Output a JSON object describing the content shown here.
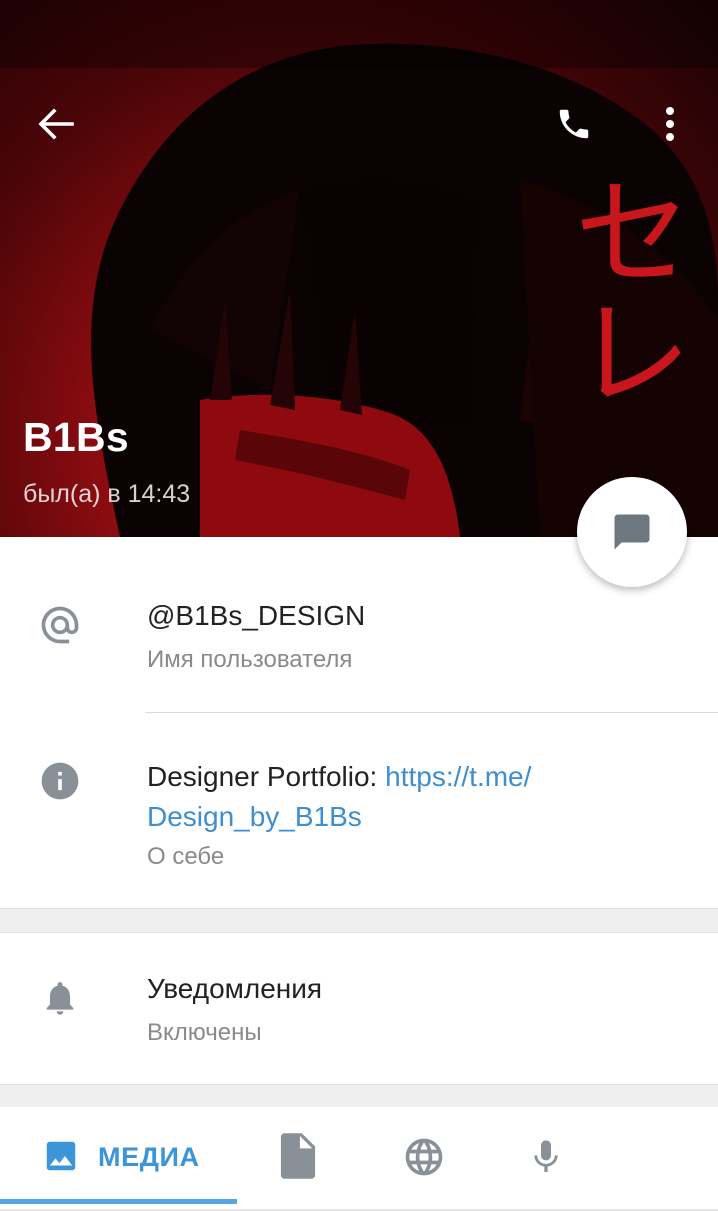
{
  "profile": {
    "name": "B1Bs",
    "last_seen": "был(а) в 14:43"
  },
  "header": {
    "back_icon": "arrow-left-icon",
    "call_icon": "phone-icon",
    "menu_icon": "more-vert-icon",
    "banner_text": "セレ"
  },
  "fab": {
    "icon": "chat-bubble-icon"
  },
  "info": {
    "username": {
      "icon": "at-sign-icon",
      "value": "@B1Bs_DESIGN",
      "label": "Имя пользователя"
    },
    "bio": {
      "icon": "info-icon",
      "text": "Designer Portfolio:",
      "link_line1": "https://t.me/",
      "link_line2": "Design_by_B1Bs",
      "label": "О себе"
    }
  },
  "notifications": {
    "icon": "bell-icon",
    "title": "Уведомления",
    "value": "Включены"
  },
  "media_tabs": {
    "active_label": "МЕДИА",
    "tabs": [
      "image-icon",
      "file-icon",
      "globe-icon",
      "microphone-icon"
    ]
  },
  "colors": {
    "accent": "#3c95d8",
    "link": "#3d8fd0",
    "banner": "#8c0c10"
  }
}
